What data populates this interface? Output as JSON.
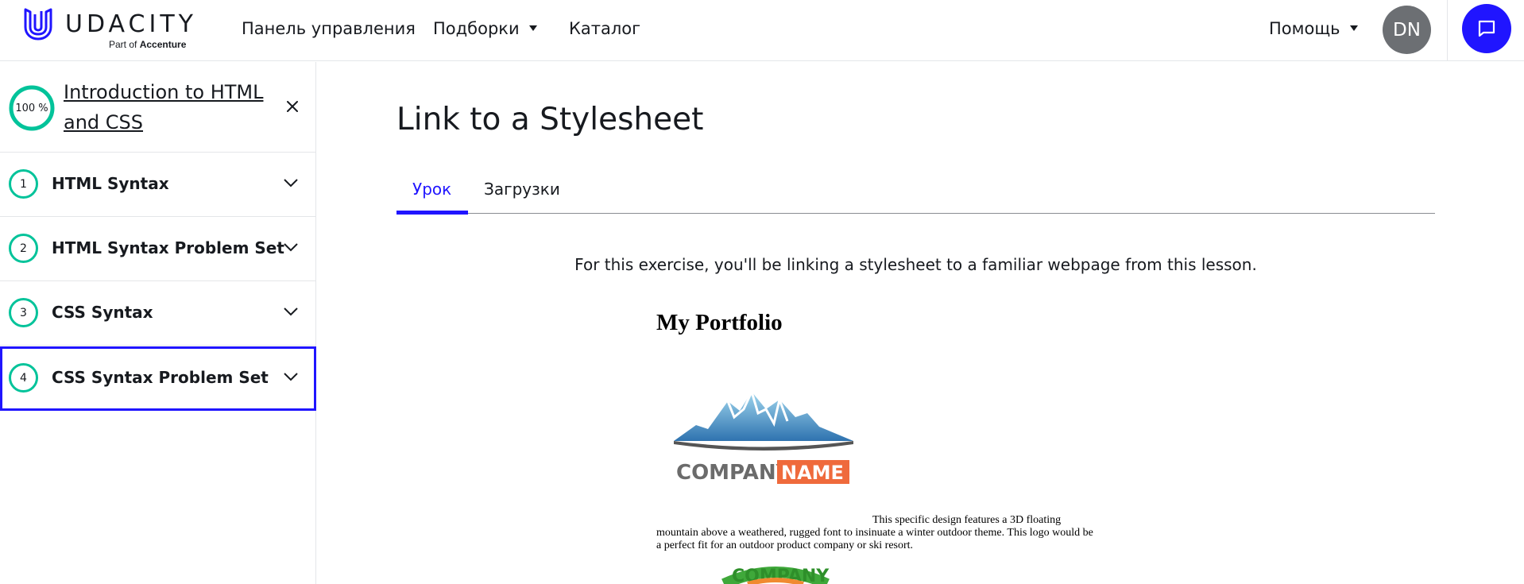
{
  "brand": {
    "name": "UDACITY",
    "tagline_prefix": "Part of",
    "tagline_company": "Accenture",
    "accent_color": "#2015ff",
    "progress_color": "#02c39a"
  },
  "nav": {
    "dashboard": "Панель управления",
    "collections": "Подборки",
    "catalog": "Каталог",
    "help": "Помощь",
    "avatar_initials": "DN"
  },
  "sidebar": {
    "progress": "100 %",
    "course_title": "Introduction to HTML and CSS",
    "lessons": [
      {
        "number": "1",
        "label": "HTML Syntax"
      },
      {
        "number": "2",
        "label": "HTML Syntax Problem Set"
      },
      {
        "number": "3",
        "label": "CSS Syntax"
      },
      {
        "number": "4",
        "label": "CSS Syntax Problem Set"
      }
    ]
  },
  "main": {
    "title": "Link to a Stylesheet",
    "tabs": [
      {
        "label": "Урок"
      },
      {
        "label": "Загрузки"
      }
    ],
    "intro": "For this exercise, you'll be linking a stylesheet to a familiar webpage from this lesson.",
    "portfolio": {
      "title": "My Portfolio",
      "logo_word1": "COMPANY",
      "logo_word2": "NAME",
      "description": "This specific design features a 3D floating mountain above a weathered, rugged font to insinuate a winter outdoor theme. This logo would be a perfect fit for an outdoor product company or ski resort.",
      "logo2_text": "COMPANY"
    }
  }
}
